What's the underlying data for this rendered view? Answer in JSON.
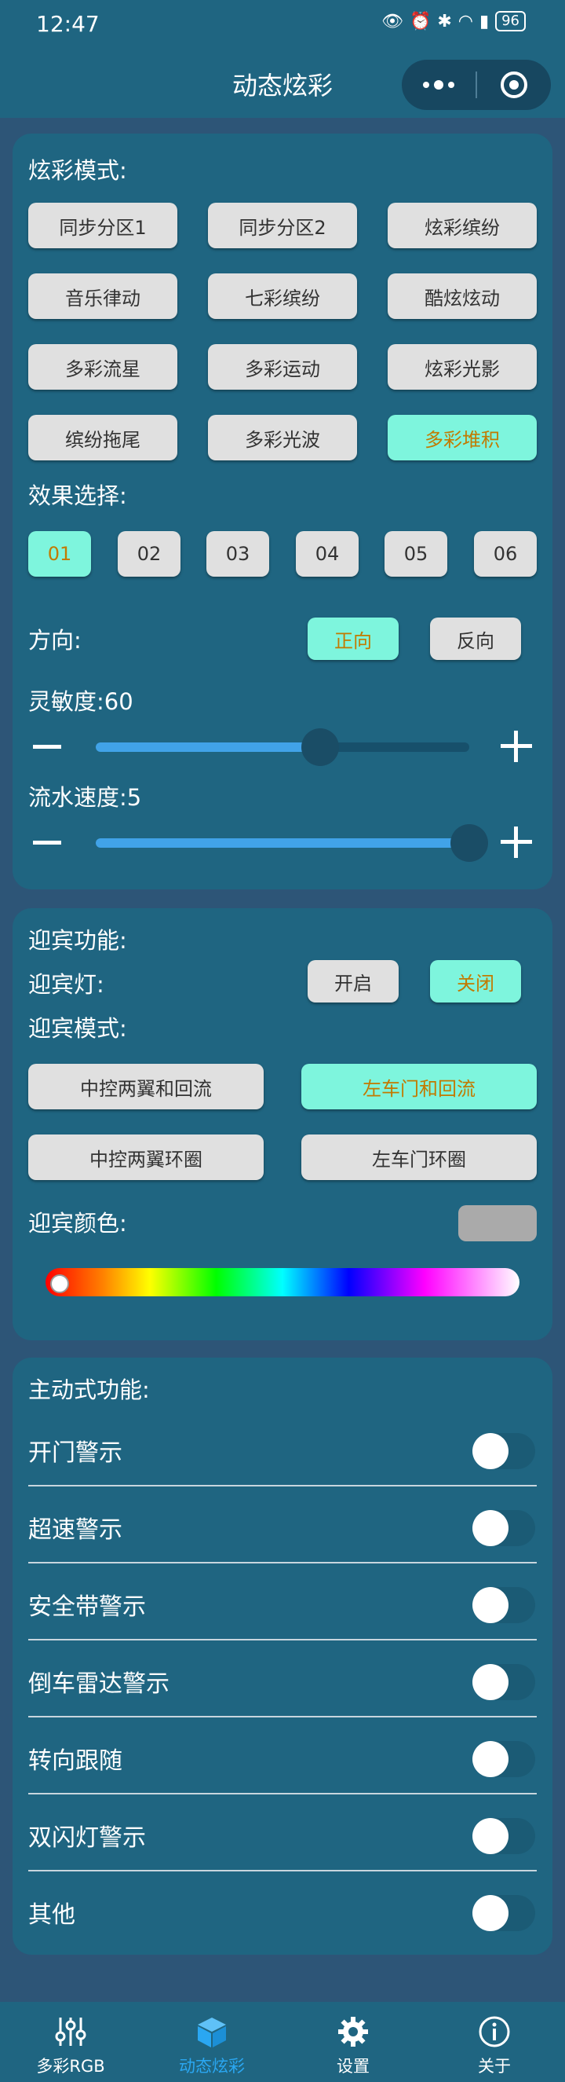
{
  "status": {
    "time": "12:47",
    "battery": "96"
  },
  "header": {
    "title": "动态炫彩"
  },
  "mode_section": {
    "title": "炫彩模式:",
    "buttons": [
      {
        "label": "同步分区1",
        "active": false
      },
      {
        "label": "同步分区2",
        "active": false
      },
      {
        "label": "炫彩缤纷",
        "active": false
      },
      {
        "label": "音乐律动",
        "active": false
      },
      {
        "label": "七彩缤纷",
        "active": false
      },
      {
        "label": "酷炫炫动",
        "active": false
      },
      {
        "label": "多彩流星",
        "active": false
      },
      {
        "label": "多彩运动",
        "active": false
      },
      {
        "label": "炫彩光影",
        "active": false
      },
      {
        "label": "缤纷拖尾",
        "active": false
      },
      {
        "label": "多彩光波",
        "active": false
      },
      {
        "label": "多彩堆积",
        "active": true
      }
    ],
    "effect_title": "效果选择:",
    "effects": [
      {
        "label": "01",
        "active": true
      },
      {
        "label": "02",
        "active": false
      },
      {
        "label": "03",
        "active": false
      },
      {
        "label": "04",
        "active": false
      },
      {
        "label": "05",
        "active": false
      },
      {
        "label": "06",
        "active": false
      }
    ],
    "direction_label": "方向:",
    "direction_forward": "正向",
    "direction_reverse": "反向",
    "sensitivity_label": "灵敏度:",
    "sensitivity_value": "60",
    "sensitivity_fraction": 0.6,
    "speed_label": "流水速度:",
    "speed_value": "5",
    "speed_fraction": 1.0
  },
  "welcome_section": {
    "title": "迎宾功能:",
    "light_label": "迎宾灯:",
    "on_label": "开启",
    "off_label": "关闭",
    "mode_label": "迎宾模式:",
    "modes": [
      {
        "label": "中控两翼和回流",
        "active": false
      },
      {
        "label": "左车门和回流",
        "active": true
      },
      {
        "label": "中控两翼环圈",
        "active": false
      },
      {
        "label": "左车门环圈",
        "active": false
      }
    ],
    "color_label": "迎宾颜色:",
    "color_swatch": "#aaaaaa"
  },
  "active_section": {
    "title": "主动式功能:",
    "items": [
      {
        "label": "开门警示",
        "on": false
      },
      {
        "label": "超速警示",
        "on": false
      },
      {
        "label": "安全带警示",
        "on": false
      },
      {
        "label": "倒车雷达警示",
        "on": false
      },
      {
        "label": "转向跟随",
        "on": false
      },
      {
        "label": "双闪灯警示",
        "on": false
      },
      {
        "label": "其他",
        "on": false
      }
    ]
  },
  "tabbar": {
    "tabs": [
      {
        "label": "多彩RGB",
        "icon": "sliders-icon"
      },
      {
        "label": "动态炫彩",
        "icon": "cube-icon",
        "active": true
      },
      {
        "label": "设置",
        "icon": "gear-icon"
      },
      {
        "label": "关于",
        "icon": "info-icon"
      }
    ]
  },
  "colors": {
    "accent": "#7ef5dd",
    "accent_text": "#c27a00",
    "card": "#1f6581",
    "background": "#2d5577",
    "tab_active": "#2aa7f2"
  }
}
